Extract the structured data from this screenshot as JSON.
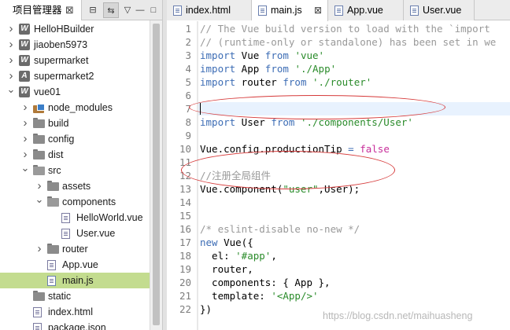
{
  "explorer": {
    "title": "项目管理器",
    "close_icon": "close-icon",
    "tree": [
      {
        "label": "HelloHBuilder",
        "depth": 0,
        "kind": "project-w",
        "chevron": "right"
      },
      {
        "label": "jiaoben5973",
        "depth": 0,
        "kind": "project-w",
        "chevron": "right"
      },
      {
        "label": "supermarket",
        "depth": 0,
        "kind": "project-w",
        "chevron": "right"
      },
      {
        "label": "supermarket2",
        "depth": 0,
        "kind": "project-a",
        "chevron": "right"
      },
      {
        "label": "vue01",
        "depth": 0,
        "kind": "project-w",
        "chevron": "down"
      },
      {
        "label": "node_modules",
        "depth": 1,
        "kind": "node-modules",
        "chevron": "right"
      },
      {
        "label": "build",
        "depth": 1,
        "kind": "folder",
        "chevron": "right"
      },
      {
        "label": "config",
        "depth": 1,
        "kind": "folder",
        "chevron": "right"
      },
      {
        "label": "dist",
        "depth": 1,
        "kind": "folder",
        "chevron": "right"
      },
      {
        "label": "src",
        "depth": 1,
        "kind": "folder-open",
        "chevron": "down"
      },
      {
        "label": "assets",
        "depth": 2,
        "kind": "folder",
        "chevron": "right"
      },
      {
        "label": "components",
        "depth": 2,
        "kind": "folder-open",
        "chevron": "down"
      },
      {
        "label": "HelloWorld.vue",
        "depth": 3,
        "kind": "file",
        "chevron": "none"
      },
      {
        "label": "User.vue",
        "depth": 3,
        "kind": "file",
        "chevron": "none"
      },
      {
        "label": "router",
        "depth": 2,
        "kind": "folder",
        "chevron": "right"
      },
      {
        "label": "App.vue",
        "depth": 2,
        "kind": "file",
        "chevron": "none"
      },
      {
        "label": "main.js",
        "depth": 2,
        "kind": "file-js",
        "chevron": "none",
        "selected": true
      },
      {
        "label": "static",
        "depth": 1,
        "kind": "folder",
        "chevron": "none"
      },
      {
        "label": "index.html",
        "depth": 1,
        "kind": "file",
        "chevron": "none"
      },
      {
        "label": "package.json",
        "depth": 1,
        "kind": "file",
        "chevron": "none"
      }
    ]
  },
  "tabs": [
    {
      "label": "index.html",
      "active": false
    },
    {
      "label": "main.js",
      "active": true
    },
    {
      "label": "App.vue",
      "active": false
    },
    {
      "label": "User.vue",
      "active": false
    }
  ],
  "editor": {
    "current_line": 7,
    "lines": [
      {
        "n": "1",
        "tokens": [
          {
            "t": "// The Vue build version to load with the `import",
            "c": "cm"
          }
        ]
      },
      {
        "n": "2",
        "tokens": [
          {
            "t": "// (runtime-only or standalone) has been set in we",
            "c": "cm"
          }
        ]
      },
      {
        "n": "3",
        "tokens": [
          {
            "t": "import",
            "c": "kw"
          },
          {
            "t": " Vue ",
            "c": ""
          },
          {
            "t": "from",
            "c": "kw"
          },
          {
            "t": " ",
            "c": ""
          },
          {
            "t": "'vue'",
            "c": "str"
          }
        ]
      },
      {
        "n": "4",
        "tokens": [
          {
            "t": "import",
            "c": "kw"
          },
          {
            "t": " App ",
            "c": ""
          },
          {
            "t": "from",
            "c": "kw"
          },
          {
            "t": " ",
            "c": ""
          },
          {
            "t": "'./App'",
            "c": "str"
          }
        ]
      },
      {
        "n": "5",
        "tokens": [
          {
            "t": "import",
            "c": "kw"
          },
          {
            "t": " router ",
            "c": ""
          },
          {
            "t": "from",
            "c": "kw"
          },
          {
            "t": " ",
            "c": ""
          },
          {
            "t": "'./router'",
            "c": "str"
          }
        ]
      },
      {
        "n": "6",
        "tokens": []
      },
      {
        "n": "7",
        "tokens": []
      },
      {
        "n": "8",
        "tokens": [
          {
            "t": "import",
            "c": "kw"
          },
          {
            "t": " User ",
            "c": ""
          },
          {
            "t": "from",
            "c": "kw"
          },
          {
            "t": " ",
            "c": ""
          },
          {
            "t": "'./components/User'",
            "c": "str"
          }
        ]
      },
      {
        "n": "9",
        "tokens": []
      },
      {
        "n": "10",
        "tokens": [
          {
            "t": "Vue.config.productionTip ",
            "c": ""
          },
          {
            "t": "=",
            "c": "kw"
          },
          {
            "t": " ",
            "c": ""
          },
          {
            "t": "false",
            "c": "bool"
          }
        ]
      },
      {
        "n": "11",
        "tokens": []
      },
      {
        "n": "12",
        "tokens": [
          {
            "t": "//注册全局组件",
            "c": "cm"
          }
        ]
      },
      {
        "n": "13",
        "tokens": [
          {
            "t": "Vue.component(",
            "c": ""
          },
          {
            "t": "\"user\"",
            "c": "str"
          },
          {
            "t": ",User);",
            "c": ""
          }
        ]
      },
      {
        "n": "14",
        "tokens": []
      },
      {
        "n": "15",
        "tokens": []
      },
      {
        "n": "16",
        "tokens": [
          {
            "t": "/* eslint-disable no-new */",
            "c": "cm"
          }
        ]
      },
      {
        "n": "17",
        "tokens": [
          {
            "t": "new",
            "c": "kw"
          },
          {
            "t": " Vue({",
            "c": ""
          }
        ]
      },
      {
        "n": "18",
        "tokens": [
          {
            "t": "  el: ",
            "c": ""
          },
          {
            "t": "'#app'",
            "c": "str"
          },
          {
            "t": ",",
            "c": ""
          }
        ]
      },
      {
        "n": "19",
        "tokens": [
          {
            "t": "  router,",
            "c": ""
          }
        ]
      },
      {
        "n": "20",
        "tokens": [
          {
            "t": "  components: { App },",
            "c": ""
          }
        ]
      },
      {
        "n": "21",
        "tokens": [
          {
            "t": "  template: ",
            "c": ""
          },
          {
            "t": "'<App/>'",
            "c": "str"
          }
        ]
      },
      {
        "n": "22",
        "tokens": [
          {
            "t": "})",
            "c": ""
          }
        ]
      }
    ]
  },
  "watermark": "https://blog.csdn.net/maihuasheng",
  "colors": {
    "keyword": "#3d6db5",
    "string": "#2a8b2a",
    "comment": "#999999",
    "boolean": "#c72e9a",
    "selection": "#c3dc8f",
    "annotation": "#d63a3a"
  }
}
